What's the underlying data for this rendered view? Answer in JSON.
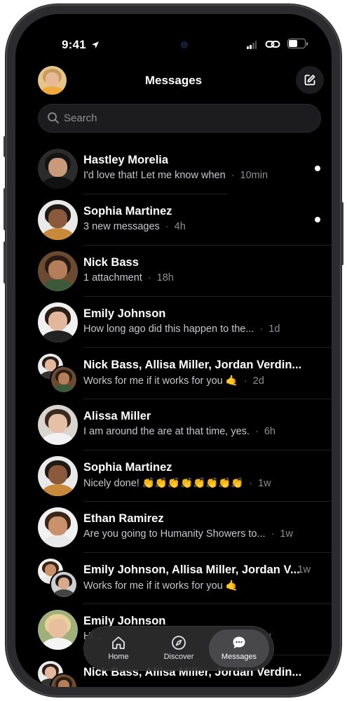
{
  "status_bar": {
    "time": "9:41"
  },
  "header": {
    "title": "Messages"
  },
  "search": {
    "placeholder": "Search"
  },
  "conversations": [
    {
      "name": "Hastley Morelia",
      "preview": "I'd love that! Let me know when",
      "ago": "10min",
      "unread": true
    },
    {
      "name": "Sophia Martinez",
      "preview": "3 new messages",
      "ago": "4h",
      "unread": true
    },
    {
      "name": "Nick Bass",
      "preview": "1 attachment",
      "ago": "18h",
      "unread": false
    },
    {
      "name": "Emily Johnson",
      "preview": "How long ago did this happen to the...",
      "ago": "1d",
      "unread": false
    },
    {
      "name": "Nick Bass, Allisa Miller, Jordan Verdin...",
      "preview": "Works for me if it works for you 🤙",
      "ago": "2d",
      "unread": false
    },
    {
      "name": "Alissa Miller",
      "preview": "I am around the are at that time, yes.",
      "ago": "6h",
      "unread": false
    },
    {
      "name": "Sophia Martinez",
      "preview": "Nicely done! 👏👏👏👏👏👏👏👏",
      "ago": "1w",
      "unread": false
    },
    {
      "name": "Ethan Ramirez",
      "preview": "Are you going to Humanity Showers to...",
      "ago": "1w",
      "unread": false
    },
    {
      "name": "Emily Johnson, Allisa Miller, Jordan V...",
      "preview": "Works for me if it works for you 🤙",
      "ago": "1w",
      "unread": false
    },
    {
      "name": "Emily Johnson",
      "preview": "Hi...",
      "ago": "1w",
      "unread": false
    },
    {
      "name": "Nick Bass, Allisa Miller, Jordan Verdin...",
      "preview": "",
      "ago": "",
      "unread": false
    }
  ],
  "tabbar": {
    "tabs": [
      {
        "label": "Home",
        "icon": "home-icon",
        "active": false
      },
      {
        "label": "Discover",
        "icon": "compass-icon",
        "active": false
      },
      {
        "label": "Messages",
        "icon": "chat-bubble-icon",
        "active": true
      }
    ]
  },
  "colors": {
    "background": "#000000",
    "text": "#ffffff",
    "muted": "#8e8e93",
    "surface": "#1c1c1e"
  }
}
